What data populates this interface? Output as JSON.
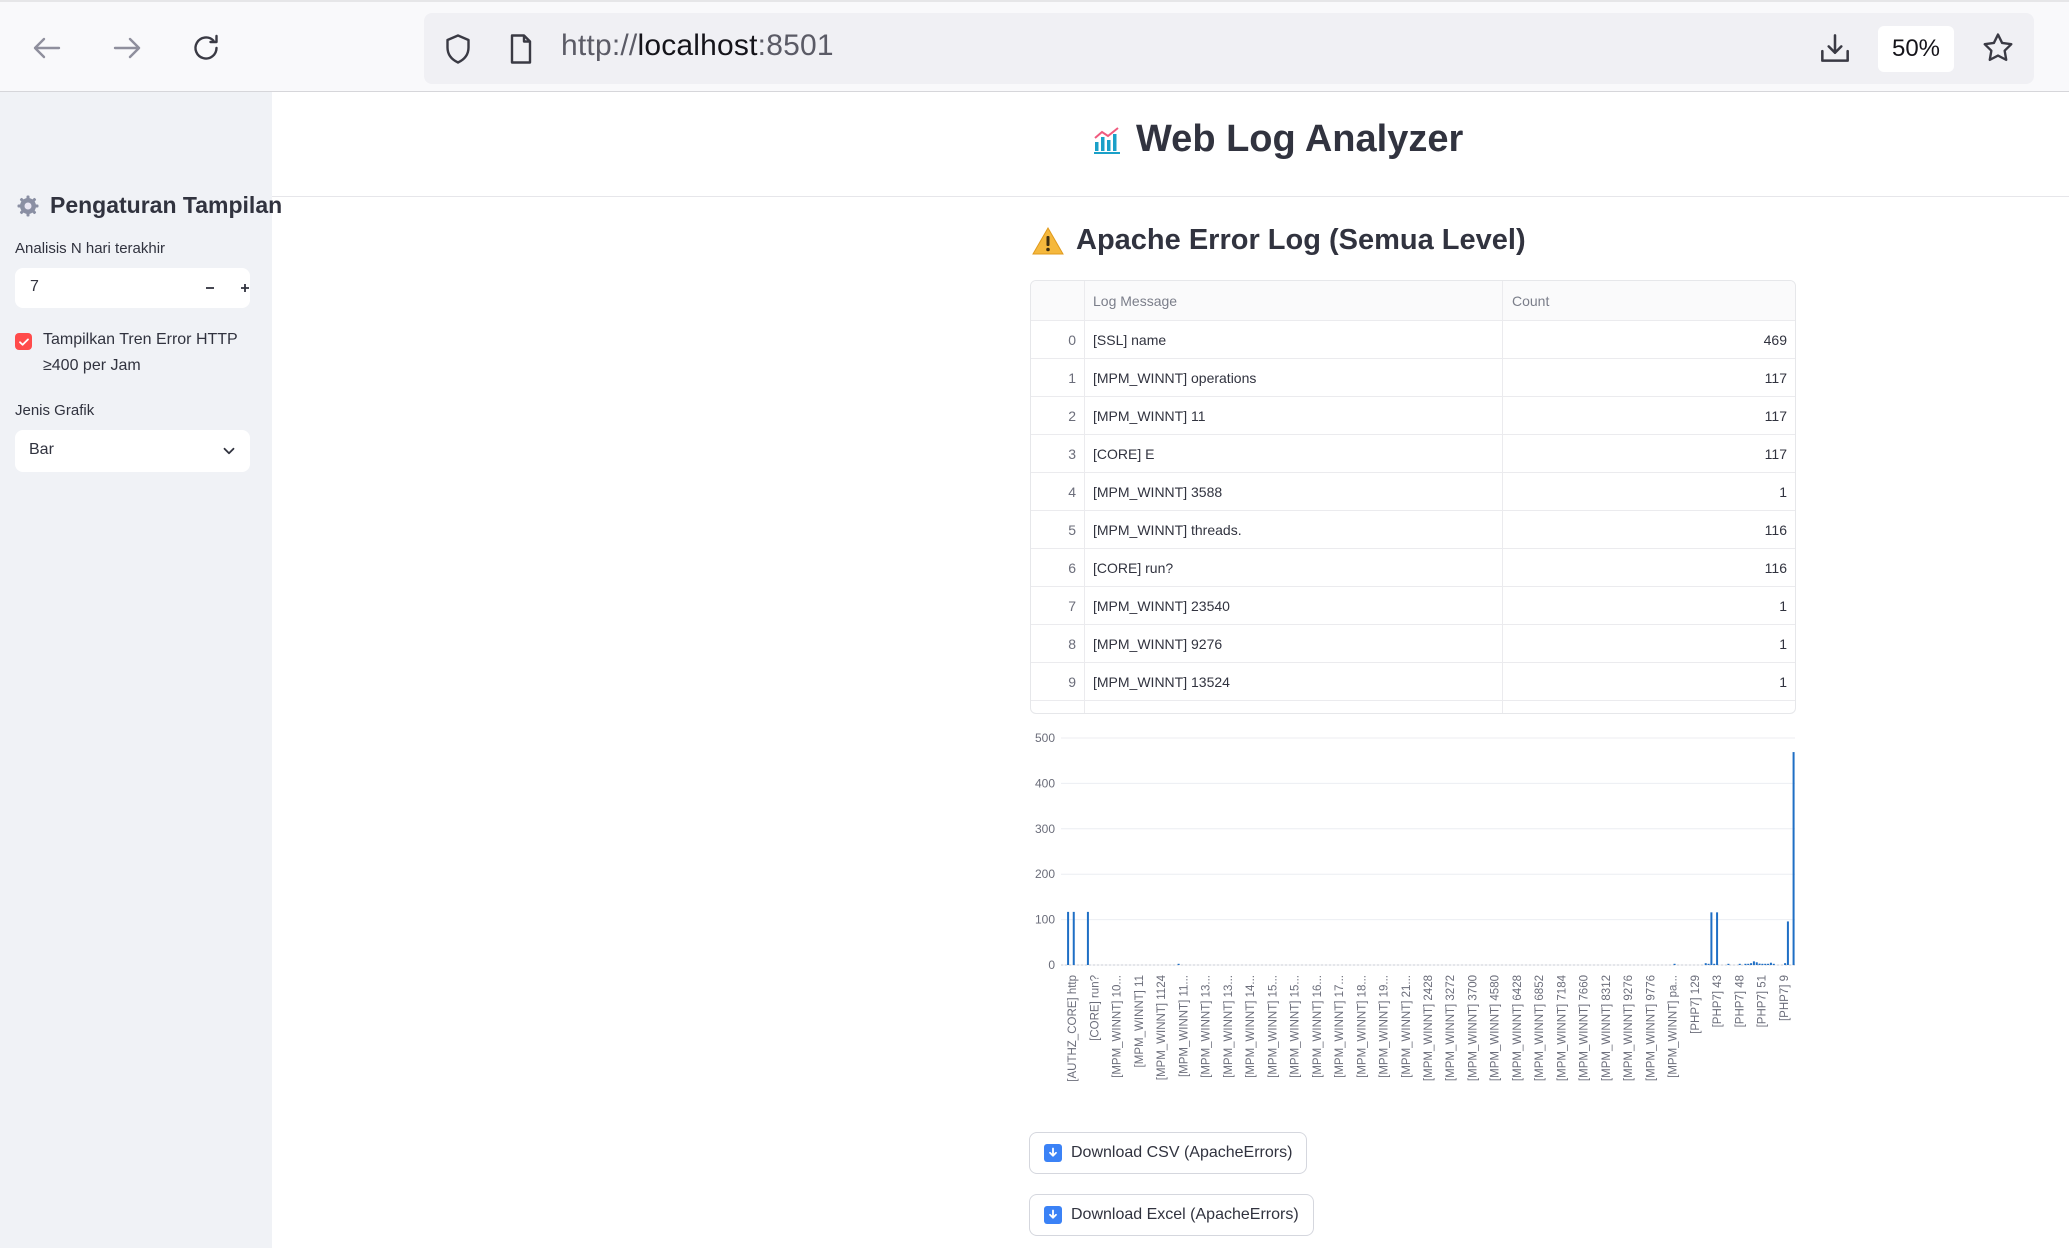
{
  "browser": {
    "url_scheme": "http://",
    "url_host": "localhost",
    "url_port": ":8501",
    "zoom": "50%"
  },
  "sidebar": {
    "title": "Pengaturan Tampilan",
    "days_label": "Analisis N hari terakhir",
    "days_value": "7",
    "checkbox_label": "Tampilkan Tren Error HTTP ≥400 per Jam",
    "checkbox_checked": true,
    "chart_type_label": "Jenis Grafik",
    "chart_type_value": "Bar"
  },
  "main": {
    "title": "Web Log Analyzer",
    "section_title": "Apache Error Log (Semua Level)",
    "table": {
      "columns": [
        "Log Message",
        "Count"
      ],
      "rows": [
        {
          "idx": "0",
          "message": "[SSL] name",
          "count": "469"
        },
        {
          "idx": "1",
          "message": "[MPM_WINNT] operations",
          "count": "117"
        },
        {
          "idx": "2",
          "message": "[MPM_WINNT] 11",
          "count": "117"
        },
        {
          "idx": "3",
          "message": "[CORE] E",
          "count": "117"
        },
        {
          "idx": "4",
          "message": "[MPM_WINNT] 3588",
          "count": "1"
        },
        {
          "idx": "5",
          "message": "[MPM_WINNT] threads.",
          "count": "116"
        },
        {
          "idx": "6",
          "message": "[CORE] run?",
          "count": "116"
        },
        {
          "idx": "7",
          "message": "[MPM_WINNT] 23540",
          "count": "1"
        },
        {
          "idx": "8",
          "message": "[MPM_WINNT] 9276",
          "count": "1"
        },
        {
          "idx": "9",
          "message": "[MPM_WINNT] 13524",
          "count": "1"
        }
      ]
    },
    "download_csv": "Download CSV (ApacheErrors)",
    "download_excel": "Download Excel (ApacheErrors)"
  },
  "colors": {
    "accent": "#ff4b4b",
    "bar": "#1f6fc5",
    "sidebar_bg": "#f0f2f6"
  },
  "chart_data": {
    "type": "bar",
    "title": "",
    "xlabel": "",
    "ylabel": "",
    "ylim": [
      0,
      500
    ],
    "yticks": [
      0,
      100,
      200,
      300,
      400,
      500
    ],
    "categories": [
      "[AUTHZ_CORE] http",
      "[CORE] run?",
      "[MPM_WINNT] 10...",
      "[MPM_WINNT] 11",
      "[MPM_WINNT] 1124",
      "[MPM_WINNT] 11...",
      "[MPM_WINNT] 13...",
      "[MPM_WINNT] 13...",
      "[MPM_WINNT] 14...",
      "[MPM_WINNT] 15...",
      "[MPM_WINNT] 15...",
      "[MPM_WINNT] 16...",
      "[MPM_WINNT] 17...",
      "[MPM_WINNT] 18...",
      "[MPM_WINNT] 19...",
      "[MPM_WINNT] 21...",
      "[MPM_WINNT] 2428",
      "[MPM_WINNT] 3272",
      "[MPM_WINNT] 3700",
      "[MPM_WINNT] 4580",
      "[MPM_WINNT] 6428",
      "[MPM_WINNT] 6852",
      "[MPM_WINNT] 7184",
      "[MPM_WINNT] 7660",
      "[MPM_WINNT] 8312",
      "[MPM_WINNT] 9276",
      "[MPM_WINNT] 9776",
      "[MPM_WINNT] pa...",
      "[PHP7] 129",
      "[PHP7] 43",
      "[PHP7] 48",
      "[PHP7] 51",
      "[PHP7] 9"
    ],
    "values": [
      0,
      0,
      117,
      0,
      117,
      0,
      0,
      0,
      0,
      117,
      0,
      0,
      0,
      0,
      0,
      0,
      0,
      0,
      0,
      0,
      0,
      0,
      0,
      0,
      0,
      0,
      0,
      0,
      0,
      0,
      0,
      0,
      0,
      0,
      0,
      0,
      0,
      0,
      0,
      0,
      0,
      1,
      0,
      0,
      0,
      0,
      0,
      0,
      0,
      0,
      0,
      0,
      0,
      0,
      0,
      0,
      0,
      0,
      0,
      0,
      0,
      0,
      0,
      0,
      0,
      0,
      0,
      0,
      0,
      0,
      0,
      0,
      0,
      0,
      0,
      0,
      0,
      0,
      0,
      0,
      0,
      0,
      0,
      0,
      0,
      0,
      0,
      0,
      0,
      0,
      0,
      0,
      0,
      0,
      0,
      0,
      0,
      0,
      0,
      0,
      0,
      0,
      0,
      0,
      0,
      0,
      0,
      0,
      0,
      0,
      0,
      0,
      0,
      0,
      0,
      0,
      0,
      0,
      0,
      0,
      0,
      0,
      0,
      0,
      0,
      0,
      0,
      0,
      0,
      0,
      0,
      0,
      0,
      0,
      0,
      0,
      0,
      0,
      0,
      0,
      0,
      0,
      0,
      0,
      0,
      0,
      0,
      0,
      0,
      0,
      0,
      0,
      0,
      0,
      0,
      0,
      0,
      0,
      0,
      0,
      0,
      0,
      0,
      0,
      0,
      0,
      0,
      0,
      0,
      0,
      0,
      0,
      0,
      0,
      0,
      0,
      0,
      0,
      0,
      0,
      0,
      0,
      0,
      0,
      0,
      0,
      0,
      0,
      0,
      0,
      0,
      0,
      0,
      0,
      0,
      0,
      0,
      0,
      0,
      0,
      0,
      0,
      0,
      0,
      0,
      0,
      0,
      0,
      0,
      0,
      0,
      0,
      0,
      0,
      0,
      0,
      1,
      0,
      0,
      0,
      0,
      0,
      0,
      0,
      0,
      0,
      0,
      4,
      2,
      116,
      1,
      116,
      0,
      0,
      0,
      1,
      0,
      0,
      0,
      1,
      0,
      1,
      2,
      4,
      8,
      6,
      3,
      2,
      1,
      2,
      5,
      1,
      0,
      0,
      0,
      4,
      96,
      0,
      469
    ]
  }
}
